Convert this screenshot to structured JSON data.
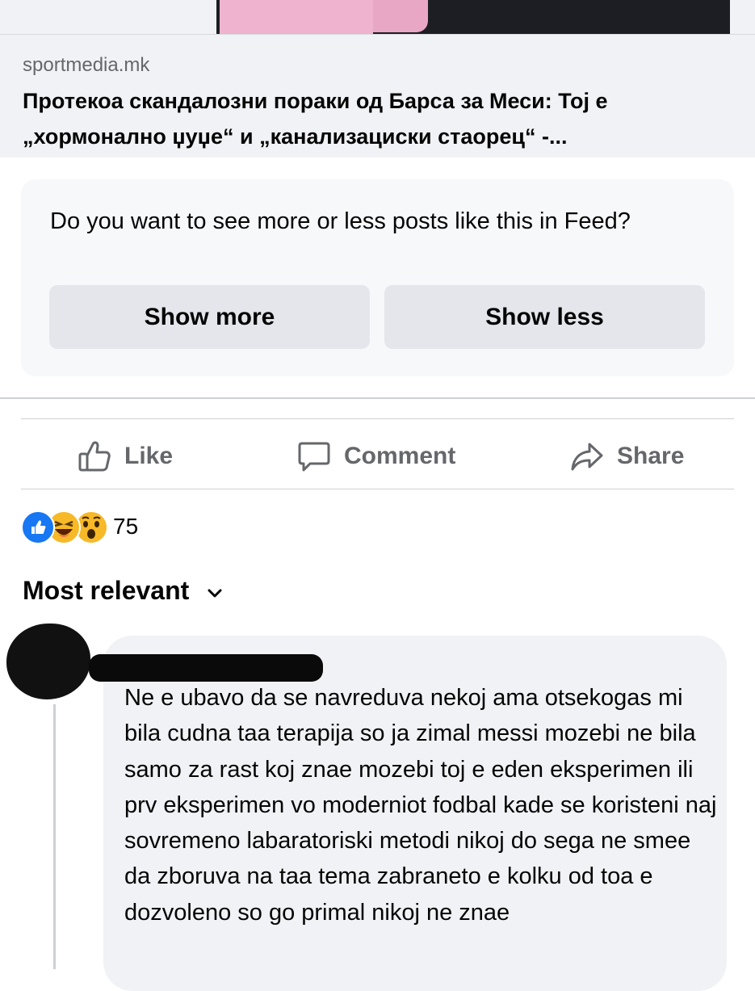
{
  "link_preview": {
    "domain": "sportmedia.mk",
    "title": "Протекоа скандалозни пораки од Барса за Меси: Тој е „хормонално џуџе“ и „канализациски стаорец“ -..."
  },
  "feedback_prompt": {
    "question": "Do you want to see more or less posts like this in Feed?",
    "show_more_label": "Show more",
    "show_less_label": "Show less"
  },
  "actions": {
    "like_label": "Like",
    "comment_label": "Comment",
    "share_label": "Share"
  },
  "reactions": {
    "types": [
      "like-icon",
      "haha-icon",
      "wow-icon"
    ],
    "count": "75"
  },
  "comments": {
    "sort_label": "Most relevant",
    "items": [
      {
        "text": "Ne e ubavo da se navreduva nekoj ama otsekogas mi bila cudna taa terapija so ja zimal messi mozebi ne bila samo za rast koj znae mozebi toj e eden eksperimen ili prv eksperimen vo moderniot fodbal kade se koristeni naj sovremeno labaratoriski metodi nikoj do sega ne smee da zboruva na taa tema zabraneto e kolku od toa e dozvoleno so go primal nikoj ne znae"
      }
    ]
  },
  "colors": {
    "accent_blue": "#1877f2",
    "secondary_text": "#65676b",
    "button_gray": "#e4e6eb",
    "reaction_yellow": "#f7b928"
  }
}
